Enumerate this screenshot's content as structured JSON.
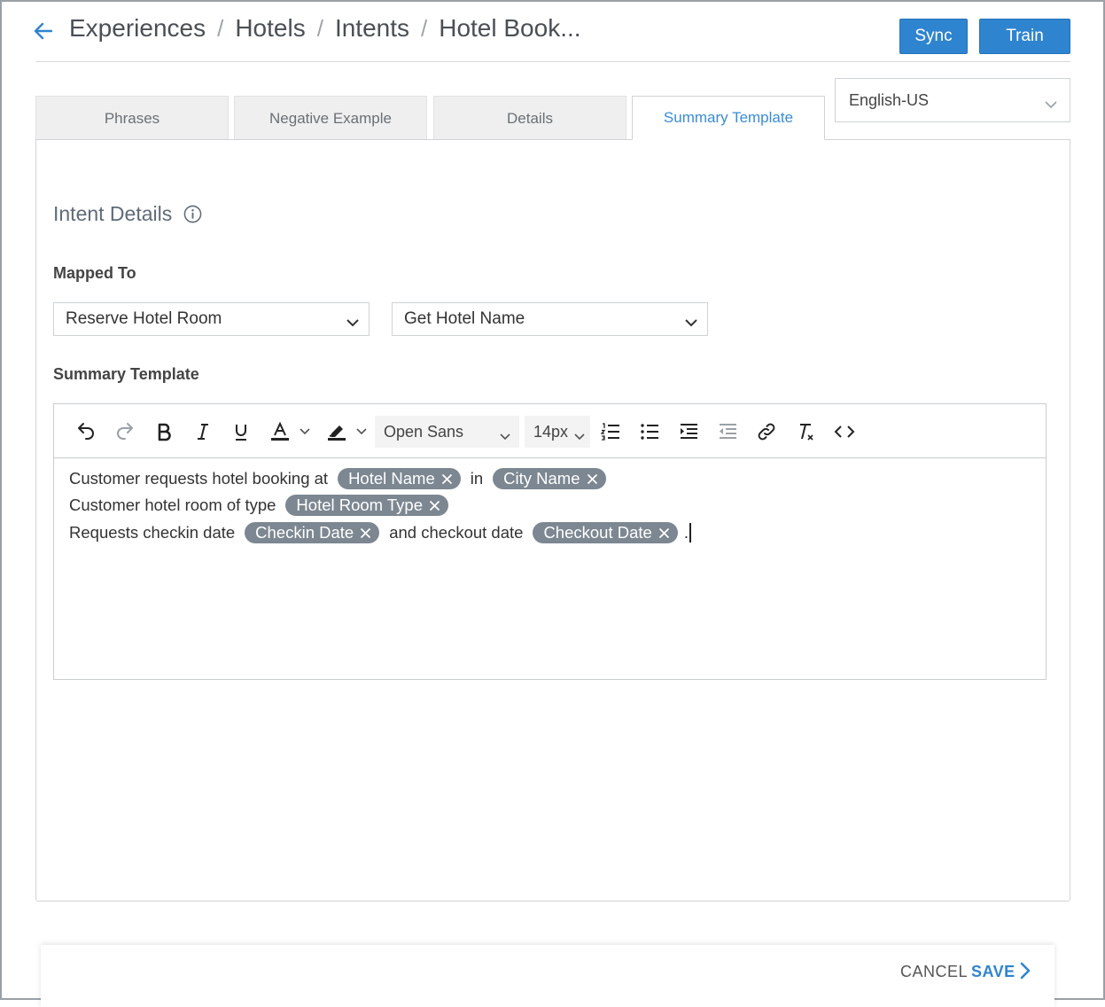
{
  "header": {
    "breadcrumb": [
      "Experiences",
      "Hotels",
      "Intents",
      "Hotel Book..."
    ],
    "separator": "/",
    "sync_label": "Sync",
    "train_label": "Train"
  },
  "tabs": [
    {
      "label": "Phrases",
      "active": false
    },
    {
      "label": "Negative Example",
      "active": false
    },
    {
      "label": "Details",
      "active": false
    },
    {
      "label": "Summary Template",
      "active": true
    }
  ],
  "language": {
    "selected": "English-US"
  },
  "panel": {
    "section_title": "Intent Details",
    "mapped_to_label": "Mapped To",
    "mapped_to_primary": "Reserve Hotel Room",
    "mapped_to_secondary": "Get Hotel Name",
    "summary_template_label": "Summary Template"
  },
  "editor": {
    "font_family": "Open Sans",
    "font_size": "14px",
    "lines": [
      [
        {
          "type": "text",
          "value": "Customer requests hotel booking at"
        },
        {
          "type": "chip",
          "value": "Hotel Name"
        },
        {
          "type": "text",
          "value": "in"
        },
        {
          "type": "chip",
          "value": "City Name"
        }
      ],
      [
        {
          "type": "text",
          "value": "Customer hotel room of type"
        },
        {
          "type": "chip",
          "value": "Hotel Room Type"
        }
      ],
      [
        {
          "type": "text",
          "value": "Requests checkin date"
        },
        {
          "type": "chip",
          "value": "Checkin Date"
        },
        {
          "type": "text",
          "value": "and checkout date"
        },
        {
          "type": "chip",
          "value": "Checkout Date"
        },
        {
          "type": "text",
          "value": "."
        }
      ]
    ]
  },
  "footer": {
    "cancel_label": "CANCEL",
    "save_label": "SAVE"
  },
  "colors": {
    "primary": "#2f84d0",
    "chip": "#7c8791",
    "active_tab_text": "#3a8cd6"
  }
}
